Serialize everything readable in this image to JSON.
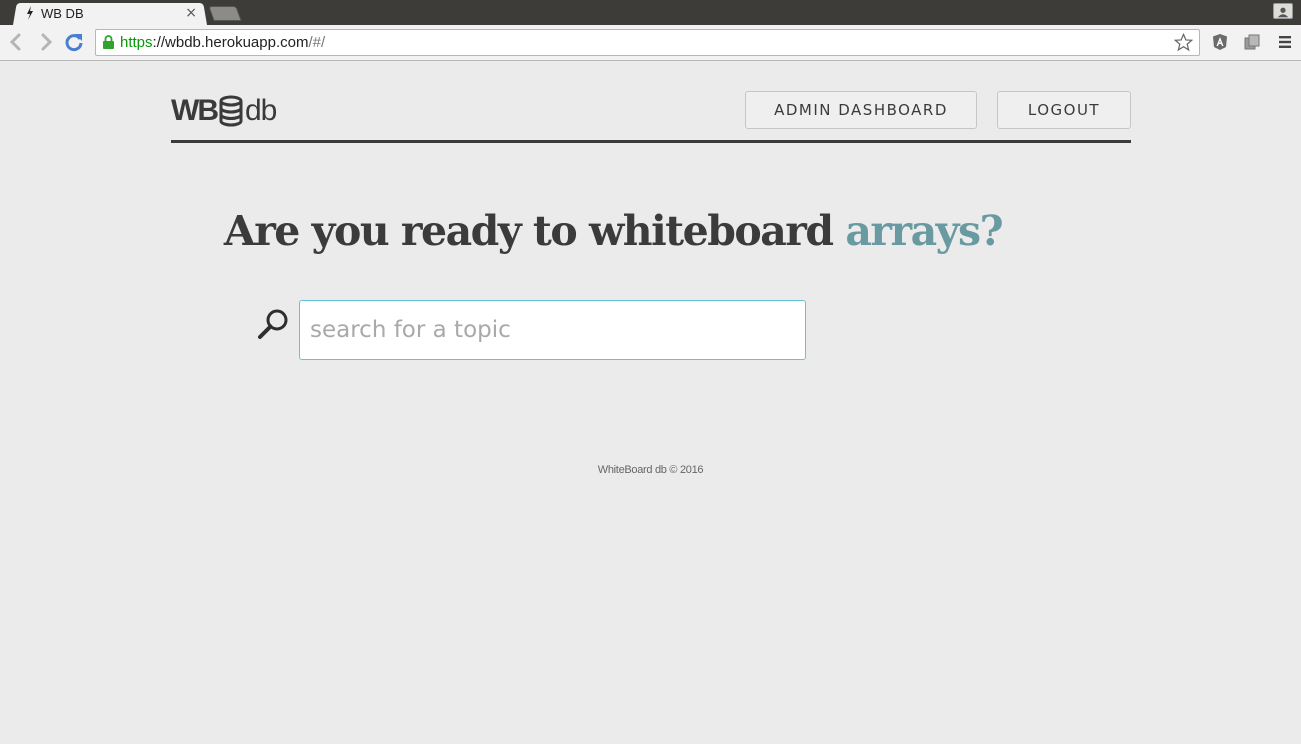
{
  "browser": {
    "tab_title": "WB DB",
    "tab_close": "×",
    "url_scheme": "https",
    "url_host": "://wbdb.herokuapp.com",
    "url_path": "/#/"
  },
  "header": {
    "logo_wb": "WB",
    "logo_db": "db",
    "admin_label": "ADMIN DASHBOARD",
    "logout_label": "LOGOUT"
  },
  "hero": {
    "headline": "Are you ready to whiteboard ",
    "topic": "arrays?",
    "topic_color": "#6a9aa1"
  },
  "search": {
    "placeholder": "search for a topic",
    "value": ""
  },
  "footer": {
    "text": "WhiteBoard db © 2016"
  },
  "icons": {
    "back": "arrow-left-icon",
    "forward": "arrow-right-icon",
    "reload": "reload-icon",
    "lock": "lock-icon",
    "star": "star-icon",
    "search": "magnifier-icon",
    "logo": "database-icon",
    "menu": "hamburger-icon"
  }
}
